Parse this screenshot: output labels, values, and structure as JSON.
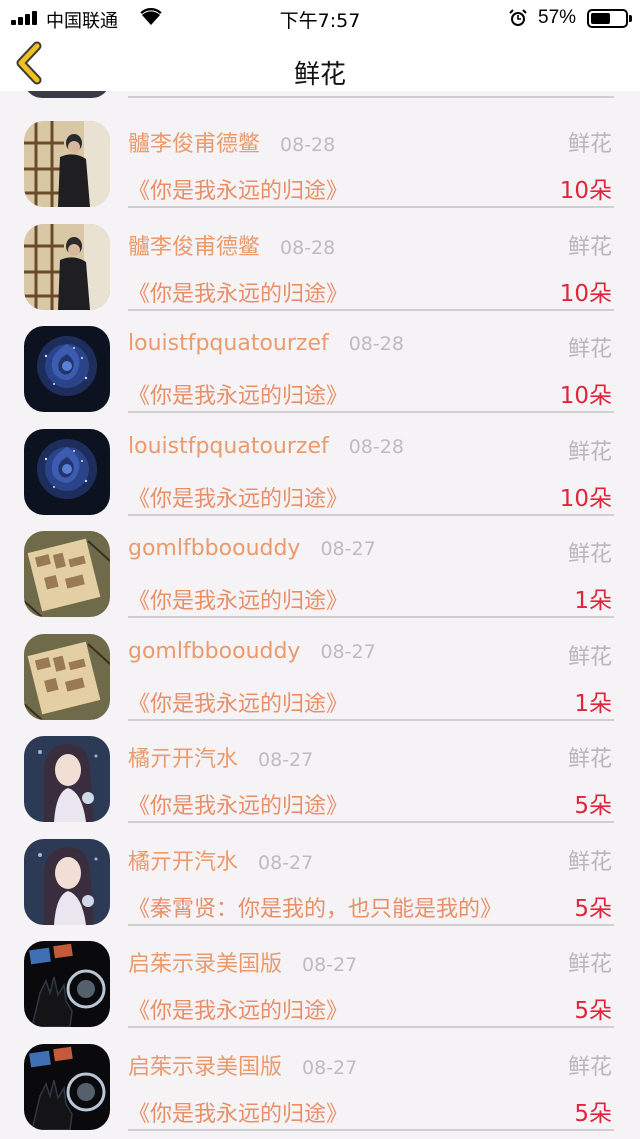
{
  "status_bar": {
    "carrier": "中国联通",
    "time": "下午7:57",
    "battery": "57%",
    "battery_level": 0.57,
    "icons": [
      "signal-icon",
      "wifi-icon",
      "alarm-icon",
      "battery-icon"
    ]
  },
  "nav": {
    "title": "鲜花",
    "back_icon": "chevron-left-icon"
  },
  "colors": {
    "accent": "#eb9a6c",
    "count": "#e0243b",
    "muted": "#b8b8b8",
    "back": "#f0c020"
  },
  "rows": [
    {
      "avatar": "man-by-window",
      "user": "髗李俊甫德鳖",
      "date": "08-28",
      "type": "鲜花",
      "work": "《你是我永远的归途》",
      "count": "10朵"
    },
    {
      "avatar": "man-by-window",
      "user": "髗李俊甫德鳖",
      "date": "08-28",
      "type": "鲜花",
      "work": "《你是我永远的归途》",
      "count": "10朵"
    },
    {
      "avatar": "blue-rose",
      "user": "louistfpquatourzef",
      "date": "08-28",
      "type": "鲜花",
      "work": "《你是我永远的归途》",
      "count": "10朵"
    },
    {
      "avatar": "blue-rose",
      "user": "louistfpquatourzef",
      "date": "08-28",
      "type": "鲜花",
      "work": "《你是我永远的归途》",
      "count": "10朵"
    },
    {
      "avatar": "wooden-box",
      "user": "gomlfbboouddy",
      "date": "08-27",
      "type": "鲜花",
      "work": "《你是我永远的归途》",
      "count": "1朵"
    },
    {
      "avatar": "wooden-box",
      "user": "gomlfbboouddy",
      "date": "08-27",
      "type": "鲜花",
      "work": "《你是我永远的归途》",
      "count": "1朵"
    },
    {
      "avatar": "anime-girl",
      "user": "橘亓开汽水",
      "date": "08-27",
      "type": "鲜花",
      "work": "《你是我永远的归途》",
      "count": "5朵"
    },
    {
      "avatar": "anime-girl",
      "user": "橘亓开汽水",
      "date": "08-27",
      "type": "鲜花",
      "work": "《秦霄贤：你是我的，也只能是我的》",
      "count": "5朵"
    },
    {
      "avatar": "hand-screen",
      "user": "启茱示录美国版",
      "date": "08-27",
      "type": "鲜花",
      "work": "《你是我永远的归途》",
      "count": "5朵"
    },
    {
      "avatar": "hand-screen",
      "user": "启茱示录美国版",
      "date": "08-27",
      "type": "鲜花",
      "work": "《你是我永远的归途》",
      "count": "5朵"
    }
  ]
}
